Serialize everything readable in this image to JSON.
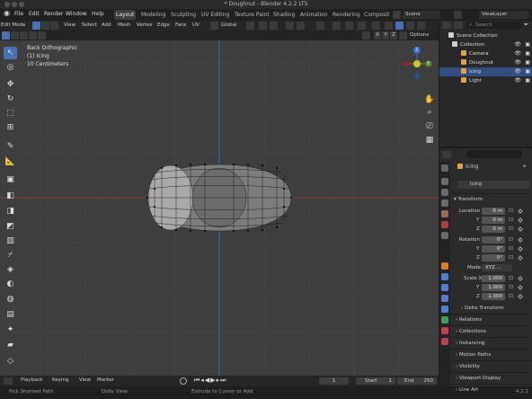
{
  "window_title": "* Doughnut - Blender 4.2.2 LTS",
  "menu": [
    "File",
    "Edit",
    "Render",
    "Window",
    "Help"
  ],
  "workspaces": [
    {
      "label": "Layout",
      "active": true
    },
    {
      "label": "Modeling",
      "active": false
    },
    {
      "label": "Sculpting",
      "active": false
    },
    {
      "label": "UV Editing",
      "active": false
    },
    {
      "label": "Texture Paint",
      "active": false
    },
    {
      "label": "Shading",
      "active": false
    },
    {
      "label": "Animation",
      "active": false
    },
    {
      "label": "Rendering",
      "active": false
    },
    {
      "label": "Composit",
      "active": false
    }
  ],
  "scene_label": "Scene",
  "viewlayer_label": "ViewLayer",
  "viewport_header": {
    "mode": "Edit Mode",
    "menus": [
      "View",
      "Select",
      "Add",
      "Mesh",
      "Vertex",
      "Edge",
      "Face",
      "UV"
    ],
    "transform_orientation": "Global",
    "options": "Options",
    "axis_toggles": [
      "X",
      "Y",
      "Z"
    ]
  },
  "viewport_info": {
    "view_name": "Back Orthographic",
    "object": "(1) Icing",
    "scale": "10 Centimeters"
  },
  "gizmo": {
    "z": "Z",
    "x": "X",
    "y": "Y"
  },
  "timeline": {
    "menus": [
      "Playback",
      "Keying",
      "View",
      "Marker"
    ],
    "current_frame": "1",
    "start_label": "Start",
    "start": "1",
    "end_label": "End",
    "end": "250"
  },
  "statusbar": {
    "left": "Pick Shortest Path",
    "middle": "Dolly View",
    "right": "Extrude to Cursor or Add",
    "version": "4.2.2"
  },
  "outliner": {
    "search_placeholder": "Search",
    "scene_collection": "Scene Collection",
    "items": [
      {
        "label": "Collection",
        "indent": 1,
        "selected": false,
        "color": "#cfcfcf"
      },
      {
        "label": "Camera",
        "indent": 2,
        "selected": false,
        "color": "#e0a24a"
      },
      {
        "label": "Doughnut",
        "indent": 2,
        "selected": false,
        "color": "#e0a24a"
      },
      {
        "label": "Icing",
        "indent": 2,
        "selected": true,
        "color": "#e0a24a"
      },
      {
        "label": "Light",
        "indent": 2,
        "selected": false,
        "color": "#e0a24a"
      }
    ]
  },
  "properties": {
    "object_name": "Icing",
    "object_field": "Icing",
    "transform_header": "Transform",
    "location_label": "Location X",
    "location": [
      "0 m",
      "0 m",
      "0 m"
    ],
    "rotation_label": "Rotation X",
    "rotation": [
      "0°",
      "0°",
      "0°"
    ],
    "mode_label": "Mode",
    "mode_value": "XYZ ...",
    "scale_label": "Scale X",
    "scale": [
      "1.000",
      "1.000",
      "1.000"
    ],
    "axis_y": "Y",
    "axis_z": "Z",
    "delta_transform": "Delta Transform",
    "panels": [
      "Relations",
      "Collections",
      "Instancing",
      "Motion Paths",
      "Visibility",
      "Viewport Display",
      "Line Art"
    ]
  },
  "colors": {
    "accent": "#4772b3",
    "viewport_bg": "#3e3e3e",
    "x_axis": "#c0392b",
    "y_axis": "#5d8c2a",
    "z_axis": "#2d6fd1"
  }
}
